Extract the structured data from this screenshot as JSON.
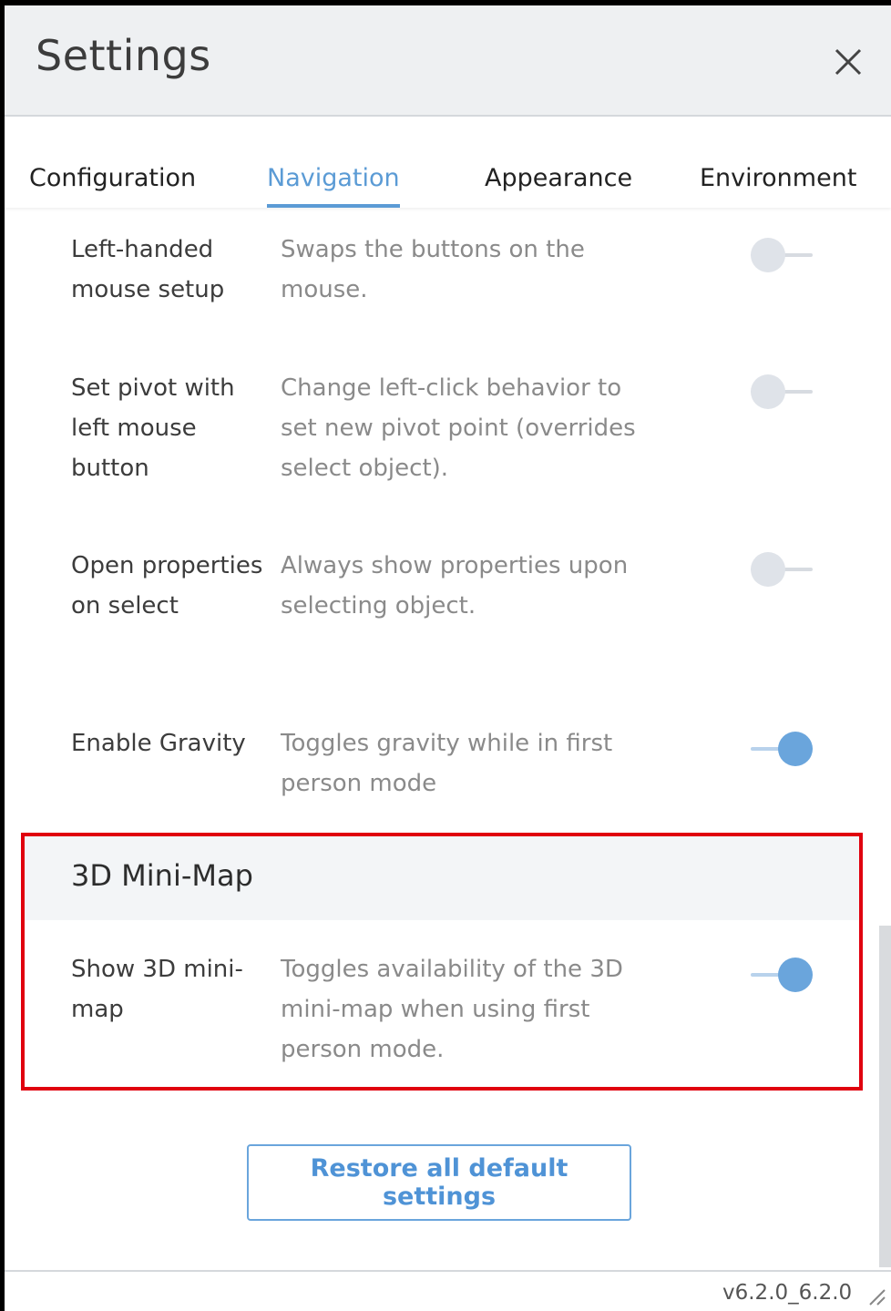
{
  "dialog": {
    "title": "Settings",
    "close_icon": "close-icon"
  },
  "tabs": [
    {
      "label": "Configuration",
      "active": false
    },
    {
      "label": "Navigation",
      "active": true
    },
    {
      "label": "Appearance",
      "active": false
    },
    {
      "label": "Environment",
      "active": false
    }
  ],
  "settings": [
    {
      "label": "Left-handed mouse setup",
      "description": "Swaps the buttons on the mouse.",
      "enabled": false
    },
    {
      "label": "Set pivot with left mouse button",
      "description": "Change left-click behavior to set new pivot point (overrides select object).",
      "enabled": false
    },
    {
      "label": "Open properties on select",
      "description": "Always show properties upon selecting object.",
      "enabled": false
    },
    {
      "label": "Enable Gravity",
      "description": "Toggles gravity while in first person mode",
      "enabled": true
    }
  ],
  "minimap_section": {
    "title": "3D Mini-Map",
    "setting": {
      "label": "Show 3D mini-map",
      "description": "Toggles availability of the 3D mini-map when using first person mode.",
      "enabled": true
    }
  },
  "restore_button": "Restore all default settings",
  "version": "v6.2.0_6.2.0",
  "colors": {
    "accent": "#5b9bd5",
    "toggle_on": "#6aa5dc",
    "highlight": "#e0000e"
  }
}
